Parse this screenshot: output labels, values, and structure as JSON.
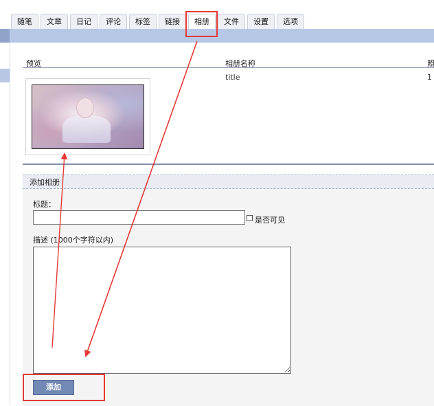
{
  "tabs": [
    {
      "label": "随笔"
    },
    {
      "label": "文章"
    },
    {
      "label": "日记"
    },
    {
      "label": "评论"
    },
    {
      "label": "标签"
    },
    {
      "label": "链接"
    },
    {
      "label": "相册"
    },
    {
      "label": "文件"
    },
    {
      "label": "设置"
    },
    {
      "label": "选项"
    }
  ],
  "active_tab": "相册",
  "table": {
    "columns": [
      "预览",
      "相册名称",
      "照"
    ],
    "rows": [
      {
        "name": "title",
        "count": "1"
      }
    ]
  },
  "form": {
    "section_title": "添加相册",
    "title_label": "标题：",
    "title_value": "",
    "visible_label": "是否可见",
    "desc_label": "描述 (1000个字符以内)",
    "desc_value": "",
    "submit_label": "添加"
  },
  "colors": {
    "accent": "#b7c8e6",
    "button": "#7189b4",
    "annotation": "#e53935"
  }
}
